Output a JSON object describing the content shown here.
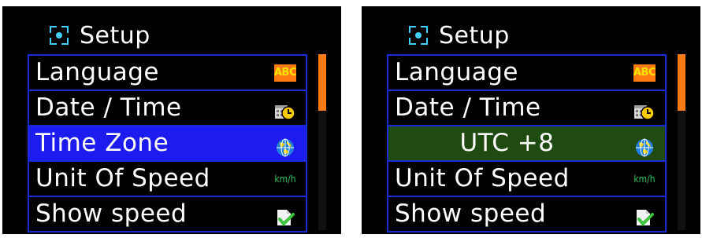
{
  "left_screen": {
    "header": {
      "title": "Setup",
      "icon": "setup-icon"
    },
    "items": [
      {
        "label": "Language",
        "icon": "abc-icon",
        "icon_text": "ABC"
      },
      {
        "label": "Date / Time",
        "icon": "calendar-clock-icon"
      },
      {
        "label": "Time Zone",
        "icon": "globe-icon",
        "selected": true
      },
      {
        "label": "Unit Of Speed",
        "icon": "kmh-icon",
        "icon_text": "km/h"
      },
      {
        "label": "Show speed",
        "icon": "checkmark-doc-icon"
      }
    ],
    "scroll_fraction": 0.32
  },
  "right_screen": {
    "header": {
      "title": "Setup",
      "icon": "setup-icon"
    },
    "items": [
      {
        "label": "Language",
        "icon": "abc-icon",
        "icon_text": "ABC"
      },
      {
        "label": "Date / Time",
        "icon": "calendar-clock-icon"
      },
      {
        "label": "UTC +8",
        "icon": "globe-icon",
        "editing": true
      },
      {
        "label": "Unit Of Speed",
        "icon": "kmh-icon",
        "icon_text": "km/h"
      },
      {
        "label": "Show speed",
        "icon": "checkmark-doc-icon"
      }
    ],
    "scroll_fraction": 0.32
  },
  "colors": {
    "background": "#000000",
    "border": "#1a2cd8",
    "selected_blue": "#1d1cf0",
    "editing_green": "#1f4a10",
    "scroll_thumb": "#ff7a10",
    "abc_bg": "#ff7a10",
    "abc_text": "#ffe600"
  }
}
